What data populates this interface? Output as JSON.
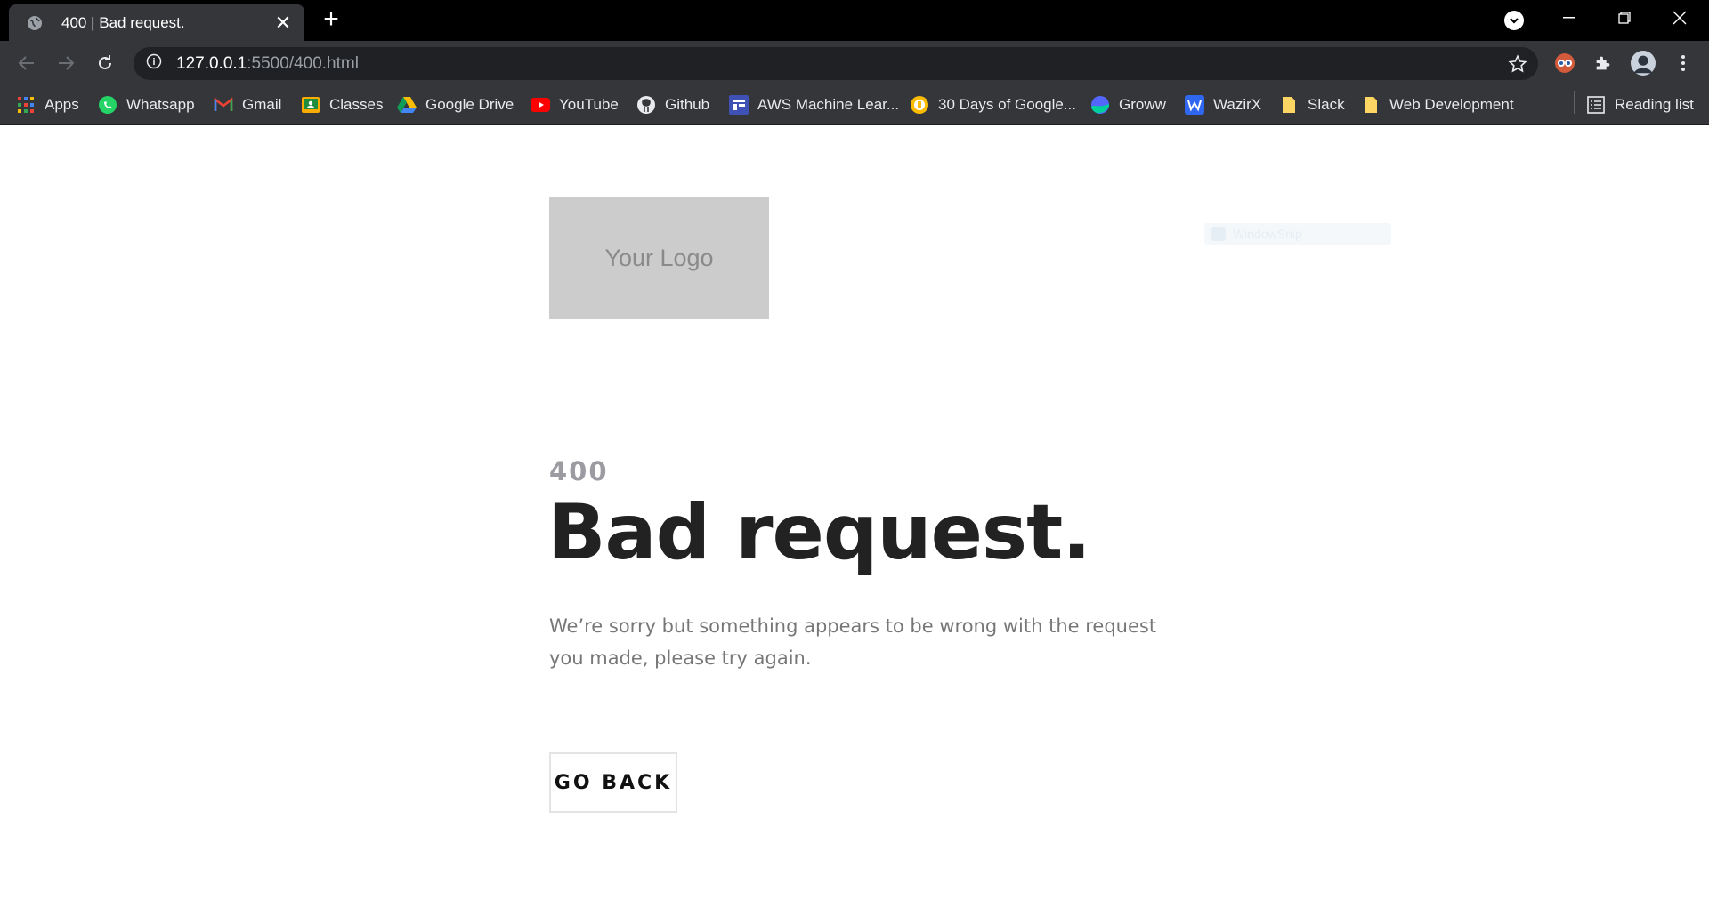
{
  "browser": {
    "tab": {
      "title": "400 | Bad request.",
      "close": "✕"
    },
    "new_tab": "+",
    "address": {
      "host": "127.0.0.1",
      "rest": ":5500/400.html"
    },
    "bookmarks": [
      {
        "label": "Apps",
        "icon": "apps-grid-icon"
      },
      {
        "label": "Whatsapp",
        "icon": "whatsapp-icon"
      },
      {
        "label": "Gmail",
        "icon": "gmail-icon"
      },
      {
        "label": "Classes",
        "icon": "google-classroom-icon"
      },
      {
        "label": "Google Drive",
        "icon": "google-drive-icon"
      },
      {
        "label": "YouTube",
        "icon": "youtube-icon"
      },
      {
        "label": "Github",
        "icon": "github-icon"
      },
      {
        "label": "AWS Machine Lear...",
        "icon": "aws-icon"
      },
      {
        "label": "30 Days of Google...",
        "icon": "google-cloud-icon"
      },
      {
        "label": "Groww",
        "icon": "groww-icon"
      },
      {
        "label": "WazirX",
        "icon": "wazirx-icon"
      },
      {
        "label": "Slack",
        "icon": "folder-icon"
      },
      {
        "label": "Web Development",
        "icon": "folder-icon"
      }
    ],
    "reading_list": "Reading list"
  },
  "page": {
    "logo_text": "Your Logo",
    "ghost_text": "WindowSnip",
    "error_code": "400",
    "headline": "Bad request.",
    "description": "We’re sorry but something appears to be wrong with the request you made, please try again.",
    "button_label": "GO BACK"
  }
}
